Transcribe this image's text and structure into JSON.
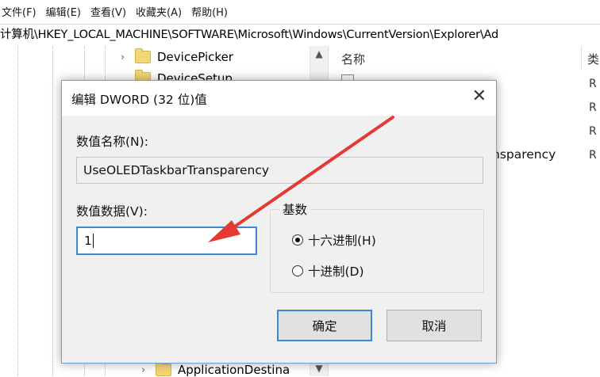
{
  "menu": {
    "items": [
      "文件(F)",
      "编辑(E)",
      "查看(V)",
      "收藏夹(A)",
      "帮助(H)"
    ]
  },
  "address": {
    "path": "计算机\\HKEY_LOCAL_MACHINE\\SOFTWARE\\Microsoft\\Windows\\CurrentVersion\\Explorer\\Ad"
  },
  "tree": {
    "items": [
      {
        "label": "DevicePicker",
        "expand": "›"
      },
      {
        "label": "DeviceSetup",
        "expand": ""
      },
      {
        "label": "ApplicationDestina",
        "expand": "›"
      }
    ]
  },
  "right_pane": {
    "name_header": "名称",
    "partial_value_name": "nsparency",
    "type_header": "类",
    "type_col_letters": [
      "R",
      "R",
      "R",
      "R"
    ]
  },
  "dialog": {
    "title": "编辑 DWORD (32 位)值",
    "value_name_label": "数值名称(N):",
    "value_name": "UseOLEDTaskbarTransparency",
    "value_data_label": "数值数据(V):",
    "value_data": "1",
    "base_label": "基数",
    "hex_label": "十六进制(H)",
    "dec_label": "十进制(D)",
    "selected_base": "hex",
    "ok_label": "确定",
    "cancel_label": "取消",
    "close_glyph": "✕"
  },
  "icons": {
    "close": "close-icon",
    "arrow": "annotation-arrow",
    "folder": "folder-icon"
  },
  "colors": {
    "annotation_arrow": "#e43a32",
    "focus_border": "#3f86d6",
    "dialog_bg": "#f0f0f0"
  }
}
